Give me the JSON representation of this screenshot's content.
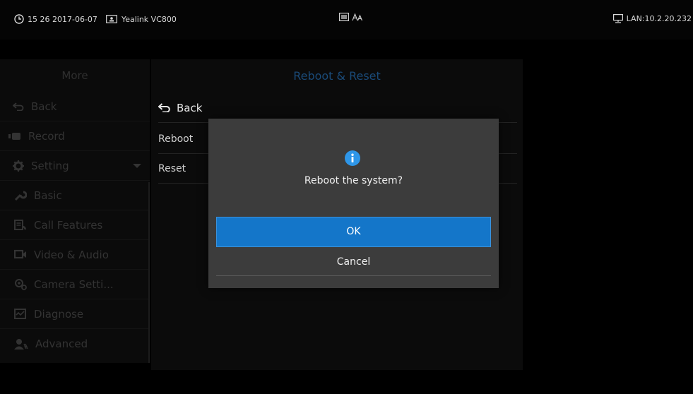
{
  "status_bar": {
    "time": "15 26",
    "date": "2017-06-07",
    "device": "Yealink VC800",
    "network": "LAN:10.2.20.232"
  },
  "left_menu": {
    "title": "More",
    "items": [
      {
        "label": "Back",
        "icon": "back-arrow-icon"
      },
      {
        "label": "Record",
        "icon": "record-icon"
      },
      {
        "label": "Setting",
        "icon": "gear-icon"
      }
    ],
    "sub_items": [
      {
        "label": "Basic",
        "icon": "wrench-icon"
      },
      {
        "label": "Call Features",
        "icon": "call-features-icon"
      },
      {
        "label": "Video & Audio",
        "icon": "video-audio-icon"
      },
      {
        "label": "Camera Setti...",
        "icon": "camera-settings-icon"
      },
      {
        "label": "Diagnose",
        "icon": "diagnose-icon"
      },
      {
        "label": "Advanced",
        "icon": "advanced-user-icon"
      }
    ]
  },
  "panel": {
    "title": "Reboot & Reset",
    "back_label": "Back",
    "rows": [
      "Reboot",
      "Reset"
    ]
  },
  "dialog": {
    "icon": "info-icon",
    "message": "Reboot the system?",
    "ok_label": "OK",
    "cancel_label": "Cancel"
  },
  "colors": {
    "accent": "#1476c9",
    "info": "#2e96e8",
    "title_blue": "#1a4a78",
    "dialog_bg": "#3c3c3c"
  }
}
